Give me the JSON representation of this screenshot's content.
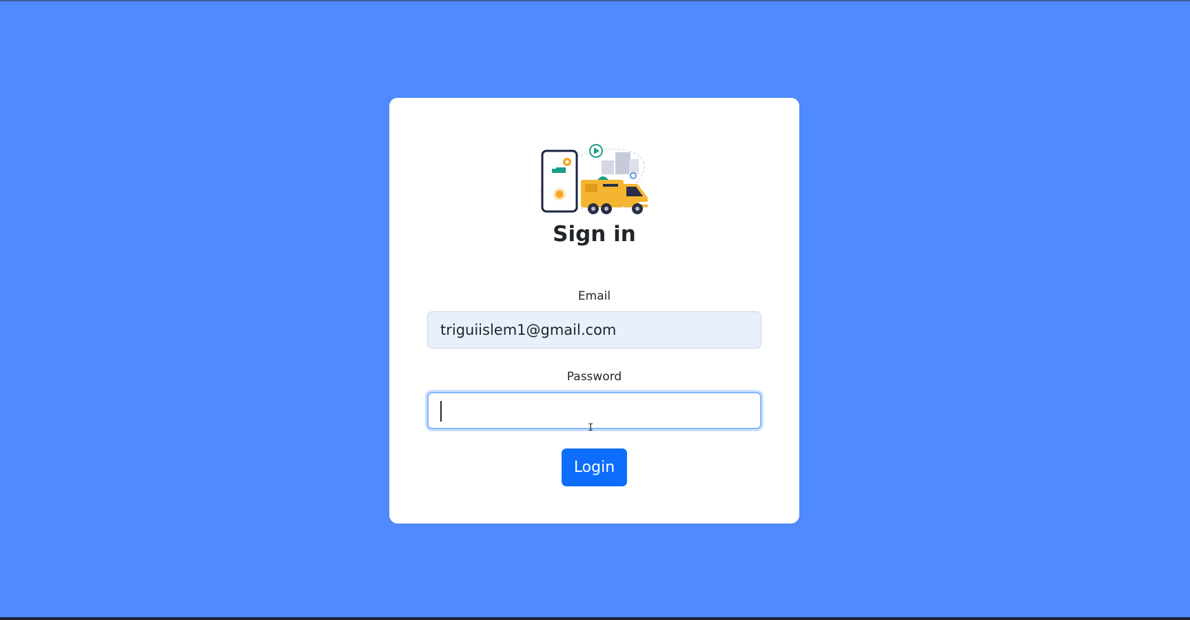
{
  "page": {
    "background_color": "#508aff"
  },
  "card": {
    "logo_icon": "delivery-truck-illustration-icon",
    "title": "Sign in"
  },
  "form": {
    "email_label": "Email",
    "email_value": "triguiislem1@gmail.com",
    "password_label": "Password",
    "password_value": "",
    "login_label": "Login",
    "accent_color": "#0d6efd"
  }
}
